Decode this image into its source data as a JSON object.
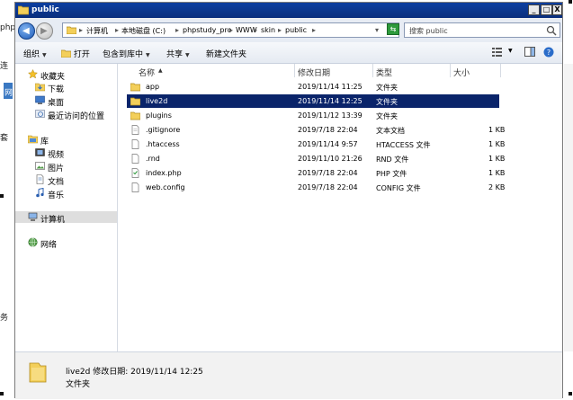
{
  "background": {
    "left_labels": [
      "php",
      "连",
      "网",
      "套",
      "务"
    ]
  },
  "window": {
    "title": "public",
    "controls": {
      "minimize": "_",
      "maximize": "□",
      "close": "X"
    }
  },
  "address": {
    "breadcrumbs": [
      "计算机",
      "本地磁盘 (C:)",
      "phpstudy_pro",
      "WWW",
      "skin",
      "public"
    ],
    "search_placeholder": "搜索 public"
  },
  "toolbar": {
    "organize": "组织",
    "open": "打开",
    "include_in_library": "包含到库中",
    "share": "共享",
    "new_folder": "新建文件夹"
  },
  "nav": {
    "favorites": {
      "label": "收藏夹",
      "items": [
        "下载",
        "桌面",
        "最近访问的位置"
      ]
    },
    "libraries": {
      "label": "库",
      "items": [
        "视频",
        "图片",
        "文档",
        "音乐"
      ]
    },
    "computer": "计算机",
    "network": "网络"
  },
  "columns": {
    "name": "名称",
    "date": "修改日期",
    "type": "类型",
    "size": "大小"
  },
  "files": [
    {
      "name": "app",
      "date": "2019/11/14 11:25",
      "type": "文件夹",
      "size": "",
      "icon": "folder-icon"
    },
    {
      "name": "live2d",
      "date": "2019/11/14 12:25",
      "type": "文件夹",
      "size": "",
      "icon": "folder-icon"
    },
    {
      "name": "plugins",
      "date": "2019/11/12 13:39",
      "type": "文件夹",
      "size": "",
      "icon": "folder-icon"
    },
    {
      "name": ".gitignore",
      "date": "2019/7/18 22:04",
      "type": "文本文档",
      "size": "1 KB",
      "icon": "text-file-icon"
    },
    {
      "name": ".htaccess",
      "date": "2019/11/14 9:57",
      "type": "HTACCESS 文件",
      "size": "1 KB",
      "icon": "file-icon"
    },
    {
      "name": ".rnd",
      "date": "2019/11/10 21:26",
      "type": "RND 文件",
      "size": "1 KB",
      "icon": "file-icon"
    },
    {
      "name": "index.php",
      "date": "2019/7/18 22:04",
      "type": "PHP 文件",
      "size": "1 KB",
      "icon": "php-file-icon"
    },
    {
      "name": "web.config",
      "date": "2019/7/18 22:04",
      "type": "CONFIG 文件",
      "size": "2 KB",
      "icon": "file-icon"
    }
  ],
  "selected_index": 1,
  "details": {
    "name": "live2d",
    "date_label": "修改日期:",
    "date": "2019/11/14 12:25",
    "type": "文件夹"
  },
  "colors": {
    "selection": "#0a246a",
    "titlebar": "#0d3fa0"
  }
}
